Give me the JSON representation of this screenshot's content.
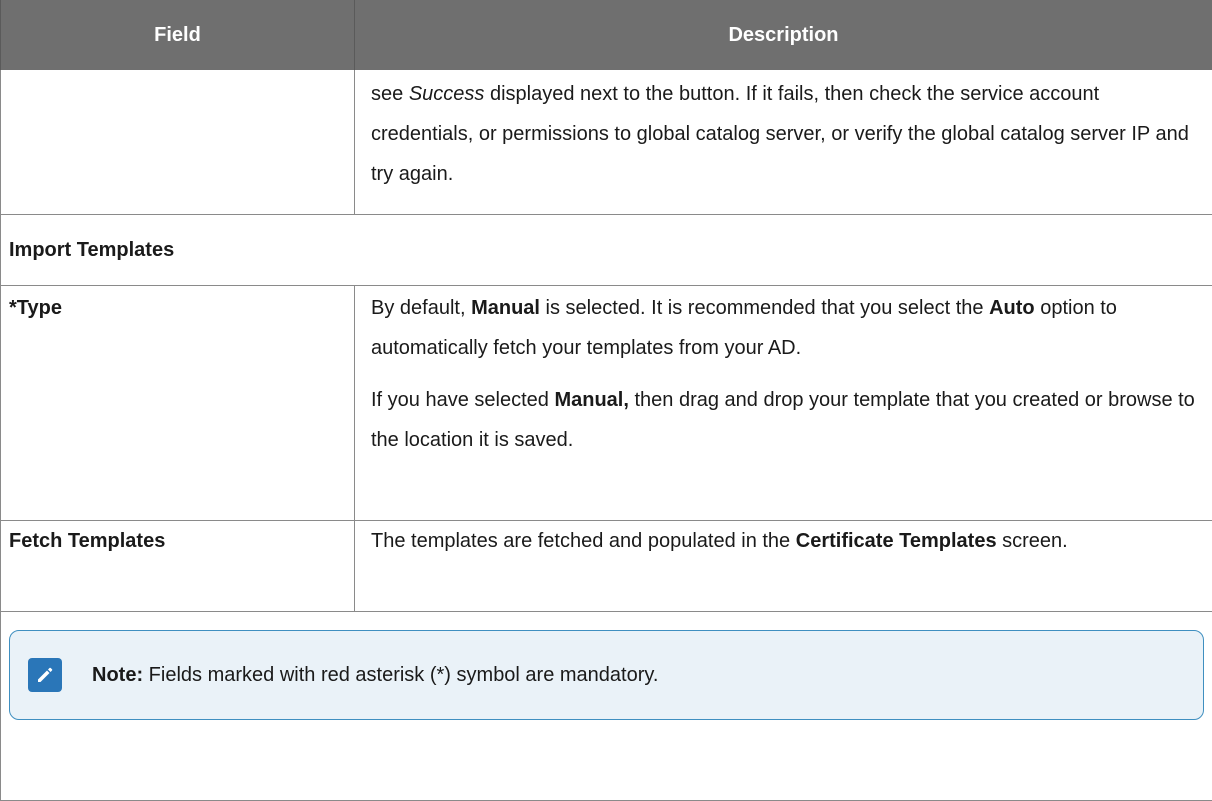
{
  "table": {
    "headers": {
      "field": "Field",
      "description": "Description"
    },
    "rows": {
      "first": {
        "field": "",
        "desc_prefix": "see ",
        "desc_italic": "Success",
        "desc_suffix": " displayed next to the button. If it fails, then check the service account credentials, or permissions to global catalog server, or verify the global catalog server IP and try again."
      },
      "section": {
        "label": "Import Templates"
      },
      "type": {
        "field": "*Type",
        "p1_a": "By default, ",
        "p1_b": "Manual",
        "p1_c": " is selected. It is recommended that you select the ",
        "p1_d": "Auto",
        "p1_e": " option to automatically fetch your templates from your AD.",
        "p2_a": "If you have selected ",
        "p2_b": "Manual,",
        "p2_c": " then drag and drop your template that you created or browse to the location it is saved."
      },
      "fetch": {
        "field": "Fetch Templates",
        "desc_a": "The templates are fetched and populated in the ",
        "desc_b": "Certificate Templates",
        "desc_c": " screen."
      }
    },
    "note": {
      "label": "Note:",
      "text": " Fields marked with red asterisk (*) symbol are mandatory.",
      "icon": "pencil-note-icon"
    }
  },
  "colors": {
    "header_bg": "#6f6f6f",
    "note_border": "#3f8fc0",
    "note_bg": "#eaf2f8",
    "note_icon_bg": "#2a76b8"
  }
}
